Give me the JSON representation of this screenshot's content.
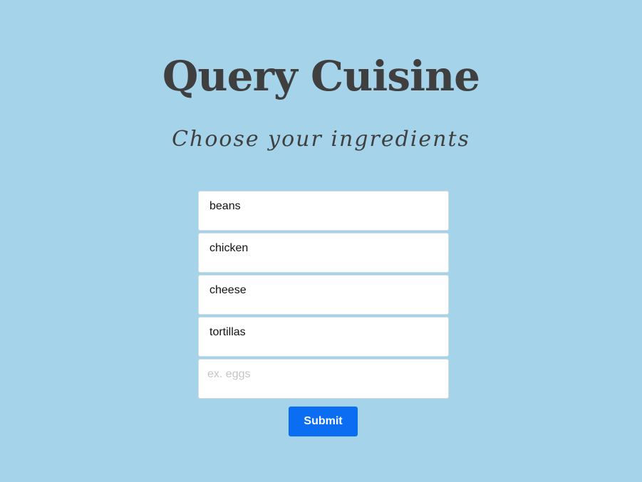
{
  "header": {
    "title": "Query Cuisine",
    "subtitle": "Choose your ingredients"
  },
  "form": {
    "ingredients": [
      {
        "value": "beans"
      },
      {
        "value": "chicken"
      },
      {
        "value": "cheese"
      },
      {
        "value": "tortillas"
      }
    ],
    "new_ingredient": {
      "value": "",
      "placeholder": "ex. eggs"
    },
    "submit_label": "Submit"
  },
  "colors": {
    "background": "#a5d4ea",
    "title_text": "#3f3f3f",
    "submit_button": "#0b6ef2",
    "field_background": "#ffffff"
  }
}
